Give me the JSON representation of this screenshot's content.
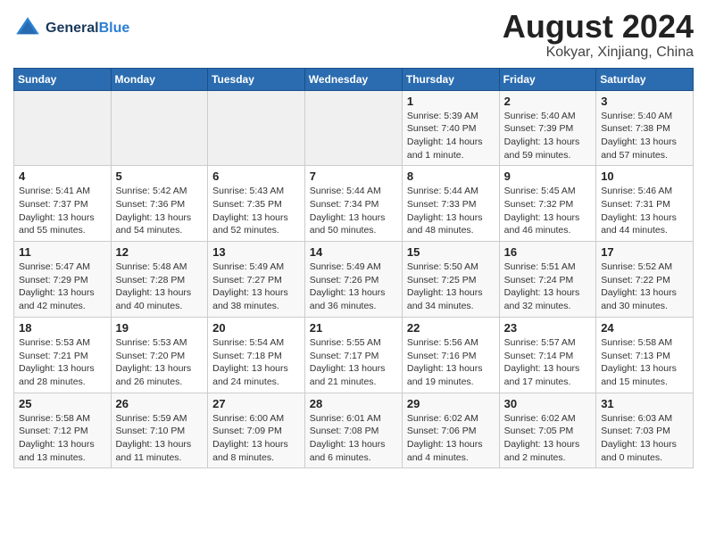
{
  "header": {
    "logo_line1": "General",
    "logo_line2": "Blue",
    "month_title": "August 2024",
    "location": "Kokyar, Xinjiang, China"
  },
  "weekdays": [
    "Sunday",
    "Monday",
    "Tuesday",
    "Wednesday",
    "Thursday",
    "Friday",
    "Saturday"
  ],
  "weeks": [
    [
      {
        "day": "",
        "info": ""
      },
      {
        "day": "",
        "info": ""
      },
      {
        "day": "",
        "info": ""
      },
      {
        "day": "",
        "info": ""
      },
      {
        "day": "1",
        "info": "Sunrise: 5:39 AM\nSunset: 7:40 PM\nDaylight: 14 hours and 1 minute."
      },
      {
        "day": "2",
        "info": "Sunrise: 5:40 AM\nSunset: 7:39 PM\nDaylight: 13 hours and 59 minutes."
      },
      {
        "day": "3",
        "info": "Sunrise: 5:40 AM\nSunset: 7:38 PM\nDaylight: 13 hours and 57 minutes."
      }
    ],
    [
      {
        "day": "4",
        "info": "Sunrise: 5:41 AM\nSunset: 7:37 PM\nDaylight: 13 hours and 55 minutes."
      },
      {
        "day": "5",
        "info": "Sunrise: 5:42 AM\nSunset: 7:36 PM\nDaylight: 13 hours and 54 minutes."
      },
      {
        "day": "6",
        "info": "Sunrise: 5:43 AM\nSunset: 7:35 PM\nDaylight: 13 hours and 52 minutes."
      },
      {
        "day": "7",
        "info": "Sunrise: 5:44 AM\nSunset: 7:34 PM\nDaylight: 13 hours and 50 minutes."
      },
      {
        "day": "8",
        "info": "Sunrise: 5:44 AM\nSunset: 7:33 PM\nDaylight: 13 hours and 48 minutes."
      },
      {
        "day": "9",
        "info": "Sunrise: 5:45 AM\nSunset: 7:32 PM\nDaylight: 13 hours and 46 minutes."
      },
      {
        "day": "10",
        "info": "Sunrise: 5:46 AM\nSunset: 7:31 PM\nDaylight: 13 hours and 44 minutes."
      }
    ],
    [
      {
        "day": "11",
        "info": "Sunrise: 5:47 AM\nSunset: 7:29 PM\nDaylight: 13 hours and 42 minutes."
      },
      {
        "day": "12",
        "info": "Sunrise: 5:48 AM\nSunset: 7:28 PM\nDaylight: 13 hours and 40 minutes."
      },
      {
        "day": "13",
        "info": "Sunrise: 5:49 AM\nSunset: 7:27 PM\nDaylight: 13 hours and 38 minutes."
      },
      {
        "day": "14",
        "info": "Sunrise: 5:49 AM\nSunset: 7:26 PM\nDaylight: 13 hours and 36 minutes."
      },
      {
        "day": "15",
        "info": "Sunrise: 5:50 AM\nSunset: 7:25 PM\nDaylight: 13 hours and 34 minutes."
      },
      {
        "day": "16",
        "info": "Sunrise: 5:51 AM\nSunset: 7:24 PM\nDaylight: 13 hours and 32 minutes."
      },
      {
        "day": "17",
        "info": "Sunrise: 5:52 AM\nSunset: 7:22 PM\nDaylight: 13 hours and 30 minutes."
      }
    ],
    [
      {
        "day": "18",
        "info": "Sunrise: 5:53 AM\nSunset: 7:21 PM\nDaylight: 13 hours and 28 minutes."
      },
      {
        "day": "19",
        "info": "Sunrise: 5:53 AM\nSunset: 7:20 PM\nDaylight: 13 hours and 26 minutes."
      },
      {
        "day": "20",
        "info": "Sunrise: 5:54 AM\nSunset: 7:18 PM\nDaylight: 13 hours and 24 minutes."
      },
      {
        "day": "21",
        "info": "Sunrise: 5:55 AM\nSunset: 7:17 PM\nDaylight: 13 hours and 21 minutes."
      },
      {
        "day": "22",
        "info": "Sunrise: 5:56 AM\nSunset: 7:16 PM\nDaylight: 13 hours and 19 minutes."
      },
      {
        "day": "23",
        "info": "Sunrise: 5:57 AM\nSunset: 7:14 PM\nDaylight: 13 hours and 17 minutes."
      },
      {
        "day": "24",
        "info": "Sunrise: 5:58 AM\nSunset: 7:13 PM\nDaylight: 13 hours and 15 minutes."
      }
    ],
    [
      {
        "day": "25",
        "info": "Sunrise: 5:58 AM\nSunset: 7:12 PM\nDaylight: 13 hours and 13 minutes."
      },
      {
        "day": "26",
        "info": "Sunrise: 5:59 AM\nSunset: 7:10 PM\nDaylight: 13 hours and 11 minutes."
      },
      {
        "day": "27",
        "info": "Sunrise: 6:00 AM\nSunset: 7:09 PM\nDaylight: 13 hours and 8 minutes."
      },
      {
        "day": "28",
        "info": "Sunrise: 6:01 AM\nSunset: 7:08 PM\nDaylight: 13 hours and 6 minutes."
      },
      {
        "day": "29",
        "info": "Sunrise: 6:02 AM\nSunset: 7:06 PM\nDaylight: 13 hours and 4 minutes."
      },
      {
        "day": "30",
        "info": "Sunrise: 6:02 AM\nSunset: 7:05 PM\nDaylight: 13 hours and 2 minutes."
      },
      {
        "day": "31",
        "info": "Sunrise: 6:03 AM\nSunset: 7:03 PM\nDaylight: 13 hours and 0 minutes."
      }
    ]
  ]
}
